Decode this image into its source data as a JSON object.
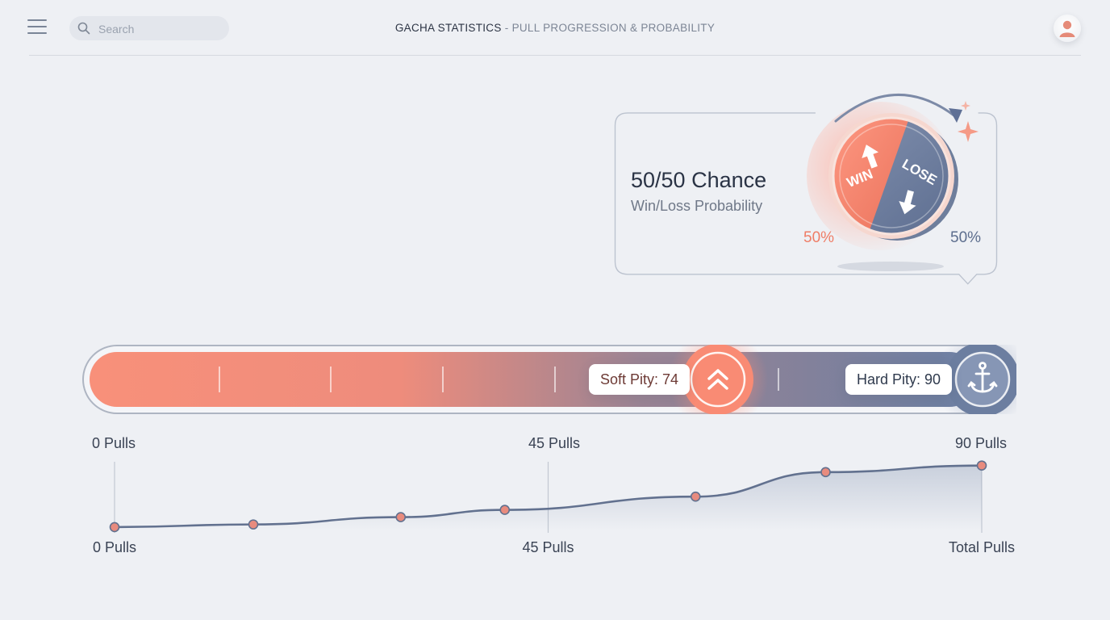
{
  "header": {
    "search_placeholder": "Search",
    "title_main": "GACHA STATISTICS",
    "title_separator": " - ",
    "title_sub": "PULL PROGRESSION & PROBABILITY",
    "menu_icon": "hamburger-menu-icon",
    "search_icon": "magnifier-icon",
    "avatar_icon": "user-avatar-icon"
  },
  "probability_card": {
    "title": "50/50 Chance",
    "subtitle": "Win/Loss Probability",
    "win_label": "WIN",
    "lose_label": "LOSE",
    "win_percent": "50%",
    "lose_percent": "50%",
    "win_fraction": 0.5,
    "colors": {
      "win": "#f0806a",
      "lose": "#6b7c9c"
    }
  },
  "progress": {
    "soft_pity_label": "Soft Pity: 74",
    "hard_pity_label": "Hard Pity: 90",
    "soft_pity_icon": "double-chevron-up-icon",
    "hard_pity_icon": "anchor-icon",
    "ticks": [
      "0 Pulls",
      "45 Pulls",
      "90 Pulls"
    ],
    "max_pulls": 90,
    "soft_pity": 74,
    "hard_pity": 90,
    "colors": {
      "start": "#f58a75",
      "end": "#6a7da0"
    }
  },
  "chart_data": {
    "type": "line",
    "x": [
      0,
      16,
      33,
      45,
      67,
      82,
      100
    ],
    "y": [
      0.05,
      0.09,
      0.2,
      0.31,
      0.51,
      0.88,
      0.98
    ],
    "x_tick_labels": [
      "0 Pulls",
      "45 Pulls",
      "Total Pulls"
    ],
    "x_tick_positions": [
      0,
      50,
      100
    ],
    "xlim": [
      0,
      100
    ],
    "ylim": [
      0,
      1
    ],
    "line_color": "#62718f",
    "marker_color": "#e88b7e",
    "grid": false
  }
}
